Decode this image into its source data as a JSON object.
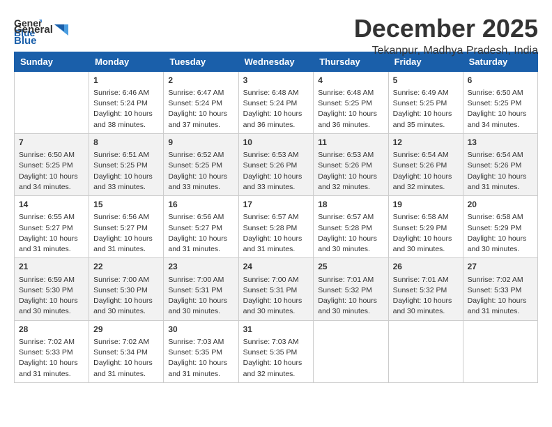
{
  "logo": {
    "general": "General",
    "blue": "Blue"
  },
  "title": {
    "month_year": "December 2025",
    "location": "Tekanpur, Madhya Pradesh, India"
  },
  "days_of_week": [
    "Sunday",
    "Monday",
    "Tuesday",
    "Wednesday",
    "Thursday",
    "Friday",
    "Saturday"
  ],
  "weeks": [
    [
      {
        "day": "",
        "content": ""
      },
      {
        "day": "1",
        "content": "Sunrise: 6:46 AM\nSunset: 5:24 PM\nDaylight: 10 hours\nand 38 minutes."
      },
      {
        "day": "2",
        "content": "Sunrise: 6:47 AM\nSunset: 5:24 PM\nDaylight: 10 hours\nand 37 minutes."
      },
      {
        "day": "3",
        "content": "Sunrise: 6:48 AM\nSunset: 5:24 PM\nDaylight: 10 hours\nand 36 minutes."
      },
      {
        "day": "4",
        "content": "Sunrise: 6:48 AM\nSunset: 5:25 PM\nDaylight: 10 hours\nand 36 minutes."
      },
      {
        "day": "5",
        "content": "Sunrise: 6:49 AM\nSunset: 5:25 PM\nDaylight: 10 hours\nand 35 minutes."
      },
      {
        "day": "6",
        "content": "Sunrise: 6:50 AM\nSunset: 5:25 PM\nDaylight: 10 hours\nand 34 minutes."
      }
    ],
    [
      {
        "day": "7",
        "content": "Sunrise: 6:50 AM\nSunset: 5:25 PM\nDaylight: 10 hours\nand 34 minutes."
      },
      {
        "day": "8",
        "content": "Sunrise: 6:51 AM\nSunset: 5:25 PM\nDaylight: 10 hours\nand 33 minutes."
      },
      {
        "day": "9",
        "content": "Sunrise: 6:52 AM\nSunset: 5:25 PM\nDaylight: 10 hours\nand 33 minutes."
      },
      {
        "day": "10",
        "content": "Sunrise: 6:53 AM\nSunset: 5:26 PM\nDaylight: 10 hours\nand 33 minutes."
      },
      {
        "day": "11",
        "content": "Sunrise: 6:53 AM\nSunset: 5:26 PM\nDaylight: 10 hours\nand 32 minutes."
      },
      {
        "day": "12",
        "content": "Sunrise: 6:54 AM\nSunset: 5:26 PM\nDaylight: 10 hours\nand 32 minutes."
      },
      {
        "day": "13",
        "content": "Sunrise: 6:54 AM\nSunset: 5:26 PM\nDaylight: 10 hours\nand 31 minutes."
      }
    ],
    [
      {
        "day": "14",
        "content": "Sunrise: 6:55 AM\nSunset: 5:27 PM\nDaylight: 10 hours\nand 31 minutes."
      },
      {
        "day": "15",
        "content": "Sunrise: 6:56 AM\nSunset: 5:27 PM\nDaylight: 10 hours\nand 31 minutes."
      },
      {
        "day": "16",
        "content": "Sunrise: 6:56 AM\nSunset: 5:27 PM\nDaylight: 10 hours\nand 31 minutes."
      },
      {
        "day": "17",
        "content": "Sunrise: 6:57 AM\nSunset: 5:28 PM\nDaylight: 10 hours\nand 31 minutes."
      },
      {
        "day": "18",
        "content": "Sunrise: 6:57 AM\nSunset: 5:28 PM\nDaylight: 10 hours\nand 30 minutes."
      },
      {
        "day": "19",
        "content": "Sunrise: 6:58 AM\nSunset: 5:29 PM\nDaylight: 10 hours\nand 30 minutes."
      },
      {
        "day": "20",
        "content": "Sunrise: 6:58 AM\nSunset: 5:29 PM\nDaylight: 10 hours\nand 30 minutes."
      }
    ],
    [
      {
        "day": "21",
        "content": "Sunrise: 6:59 AM\nSunset: 5:30 PM\nDaylight: 10 hours\nand 30 minutes."
      },
      {
        "day": "22",
        "content": "Sunrise: 7:00 AM\nSunset: 5:30 PM\nDaylight: 10 hours\nand 30 minutes."
      },
      {
        "day": "23",
        "content": "Sunrise: 7:00 AM\nSunset: 5:31 PM\nDaylight: 10 hours\nand 30 minutes."
      },
      {
        "day": "24",
        "content": "Sunrise: 7:00 AM\nSunset: 5:31 PM\nDaylight: 10 hours\nand 30 minutes."
      },
      {
        "day": "25",
        "content": "Sunrise: 7:01 AM\nSunset: 5:32 PM\nDaylight: 10 hours\nand 30 minutes."
      },
      {
        "day": "26",
        "content": "Sunrise: 7:01 AM\nSunset: 5:32 PM\nDaylight: 10 hours\nand 30 minutes."
      },
      {
        "day": "27",
        "content": "Sunrise: 7:02 AM\nSunset: 5:33 PM\nDaylight: 10 hours\nand 31 minutes."
      }
    ],
    [
      {
        "day": "28",
        "content": "Sunrise: 7:02 AM\nSunset: 5:33 PM\nDaylight: 10 hours\nand 31 minutes."
      },
      {
        "day": "29",
        "content": "Sunrise: 7:02 AM\nSunset: 5:34 PM\nDaylight: 10 hours\nand 31 minutes."
      },
      {
        "day": "30",
        "content": "Sunrise: 7:03 AM\nSunset: 5:35 PM\nDaylight: 10 hours\nand 31 minutes."
      },
      {
        "day": "31",
        "content": "Sunrise: 7:03 AM\nSunset: 5:35 PM\nDaylight: 10 hours\nand 32 minutes."
      },
      {
        "day": "",
        "content": ""
      },
      {
        "day": "",
        "content": ""
      },
      {
        "day": "",
        "content": ""
      }
    ]
  ]
}
